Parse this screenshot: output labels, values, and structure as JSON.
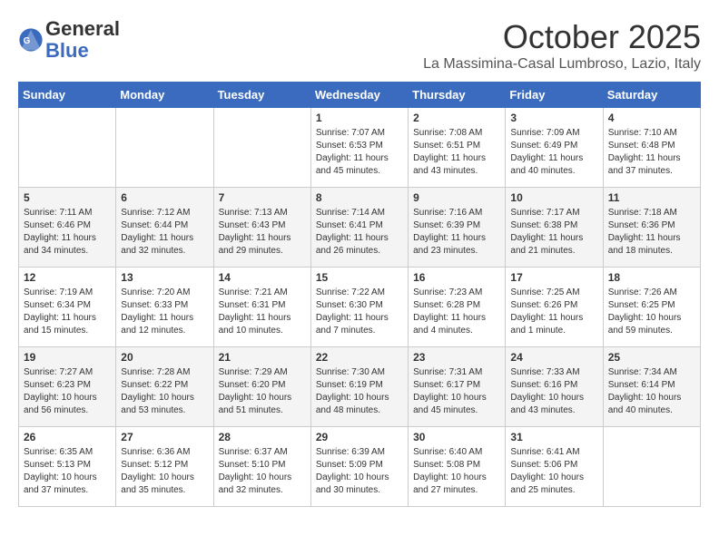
{
  "header": {
    "logo_general": "General",
    "logo_blue": "Blue",
    "title": "October 2025",
    "subtitle": "La Massimina-Casal Lumbroso, Lazio, Italy"
  },
  "weekdays": [
    "Sunday",
    "Monday",
    "Tuesday",
    "Wednesday",
    "Thursday",
    "Friday",
    "Saturday"
  ],
  "weeks": [
    [
      {
        "day": "",
        "info": ""
      },
      {
        "day": "",
        "info": ""
      },
      {
        "day": "",
        "info": ""
      },
      {
        "day": "1",
        "info": "Sunrise: 7:07 AM\nSunset: 6:53 PM\nDaylight: 11 hours\nand 45 minutes."
      },
      {
        "day": "2",
        "info": "Sunrise: 7:08 AM\nSunset: 6:51 PM\nDaylight: 11 hours\nand 43 minutes."
      },
      {
        "day": "3",
        "info": "Sunrise: 7:09 AM\nSunset: 6:49 PM\nDaylight: 11 hours\nand 40 minutes."
      },
      {
        "day": "4",
        "info": "Sunrise: 7:10 AM\nSunset: 6:48 PM\nDaylight: 11 hours\nand 37 minutes."
      }
    ],
    [
      {
        "day": "5",
        "info": "Sunrise: 7:11 AM\nSunset: 6:46 PM\nDaylight: 11 hours\nand 34 minutes."
      },
      {
        "day": "6",
        "info": "Sunrise: 7:12 AM\nSunset: 6:44 PM\nDaylight: 11 hours\nand 32 minutes."
      },
      {
        "day": "7",
        "info": "Sunrise: 7:13 AM\nSunset: 6:43 PM\nDaylight: 11 hours\nand 29 minutes."
      },
      {
        "day": "8",
        "info": "Sunrise: 7:14 AM\nSunset: 6:41 PM\nDaylight: 11 hours\nand 26 minutes."
      },
      {
        "day": "9",
        "info": "Sunrise: 7:16 AM\nSunset: 6:39 PM\nDaylight: 11 hours\nand 23 minutes."
      },
      {
        "day": "10",
        "info": "Sunrise: 7:17 AM\nSunset: 6:38 PM\nDaylight: 11 hours\nand 21 minutes."
      },
      {
        "day": "11",
        "info": "Sunrise: 7:18 AM\nSunset: 6:36 PM\nDaylight: 11 hours\nand 18 minutes."
      }
    ],
    [
      {
        "day": "12",
        "info": "Sunrise: 7:19 AM\nSunset: 6:34 PM\nDaylight: 11 hours\nand 15 minutes."
      },
      {
        "day": "13",
        "info": "Sunrise: 7:20 AM\nSunset: 6:33 PM\nDaylight: 11 hours\nand 12 minutes."
      },
      {
        "day": "14",
        "info": "Sunrise: 7:21 AM\nSunset: 6:31 PM\nDaylight: 11 hours\nand 10 minutes."
      },
      {
        "day": "15",
        "info": "Sunrise: 7:22 AM\nSunset: 6:30 PM\nDaylight: 11 hours\nand 7 minutes."
      },
      {
        "day": "16",
        "info": "Sunrise: 7:23 AM\nSunset: 6:28 PM\nDaylight: 11 hours\nand 4 minutes."
      },
      {
        "day": "17",
        "info": "Sunrise: 7:25 AM\nSunset: 6:26 PM\nDaylight: 11 hours\nand 1 minute."
      },
      {
        "day": "18",
        "info": "Sunrise: 7:26 AM\nSunset: 6:25 PM\nDaylight: 10 hours\nand 59 minutes."
      }
    ],
    [
      {
        "day": "19",
        "info": "Sunrise: 7:27 AM\nSunset: 6:23 PM\nDaylight: 10 hours\nand 56 minutes."
      },
      {
        "day": "20",
        "info": "Sunrise: 7:28 AM\nSunset: 6:22 PM\nDaylight: 10 hours\nand 53 minutes."
      },
      {
        "day": "21",
        "info": "Sunrise: 7:29 AM\nSunset: 6:20 PM\nDaylight: 10 hours\nand 51 minutes."
      },
      {
        "day": "22",
        "info": "Sunrise: 7:30 AM\nSunset: 6:19 PM\nDaylight: 10 hours\nand 48 minutes."
      },
      {
        "day": "23",
        "info": "Sunrise: 7:31 AM\nSunset: 6:17 PM\nDaylight: 10 hours\nand 45 minutes."
      },
      {
        "day": "24",
        "info": "Sunrise: 7:33 AM\nSunset: 6:16 PM\nDaylight: 10 hours\nand 43 minutes."
      },
      {
        "day": "25",
        "info": "Sunrise: 7:34 AM\nSunset: 6:14 PM\nDaylight: 10 hours\nand 40 minutes."
      }
    ],
    [
      {
        "day": "26",
        "info": "Sunrise: 6:35 AM\nSunset: 5:13 PM\nDaylight: 10 hours\nand 37 minutes."
      },
      {
        "day": "27",
        "info": "Sunrise: 6:36 AM\nSunset: 5:12 PM\nDaylight: 10 hours\nand 35 minutes."
      },
      {
        "day": "28",
        "info": "Sunrise: 6:37 AM\nSunset: 5:10 PM\nDaylight: 10 hours\nand 32 minutes."
      },
      {
        "day": "29",
        "info": "Sunrise: 6:39 AM\nSunset: 5:09 PM\nDaylight: 10 hours\nand 30 minutes."
      },
      {
        "day": "30",
        "info": "Sunrise: 6:40 AM\nSunset: 5:08 PM\nDaylight: 10 hours\nand 27 minutes."
      },
      {
        "day": "31",
        "info": "Sunrise: 6:41 AM\nSunset: 5:06 PM\nDaylight: 10 hours\nand 25 minutes."
      },
      {
        "day": "",
        "info": ""
      }
    ]
  ]
}
